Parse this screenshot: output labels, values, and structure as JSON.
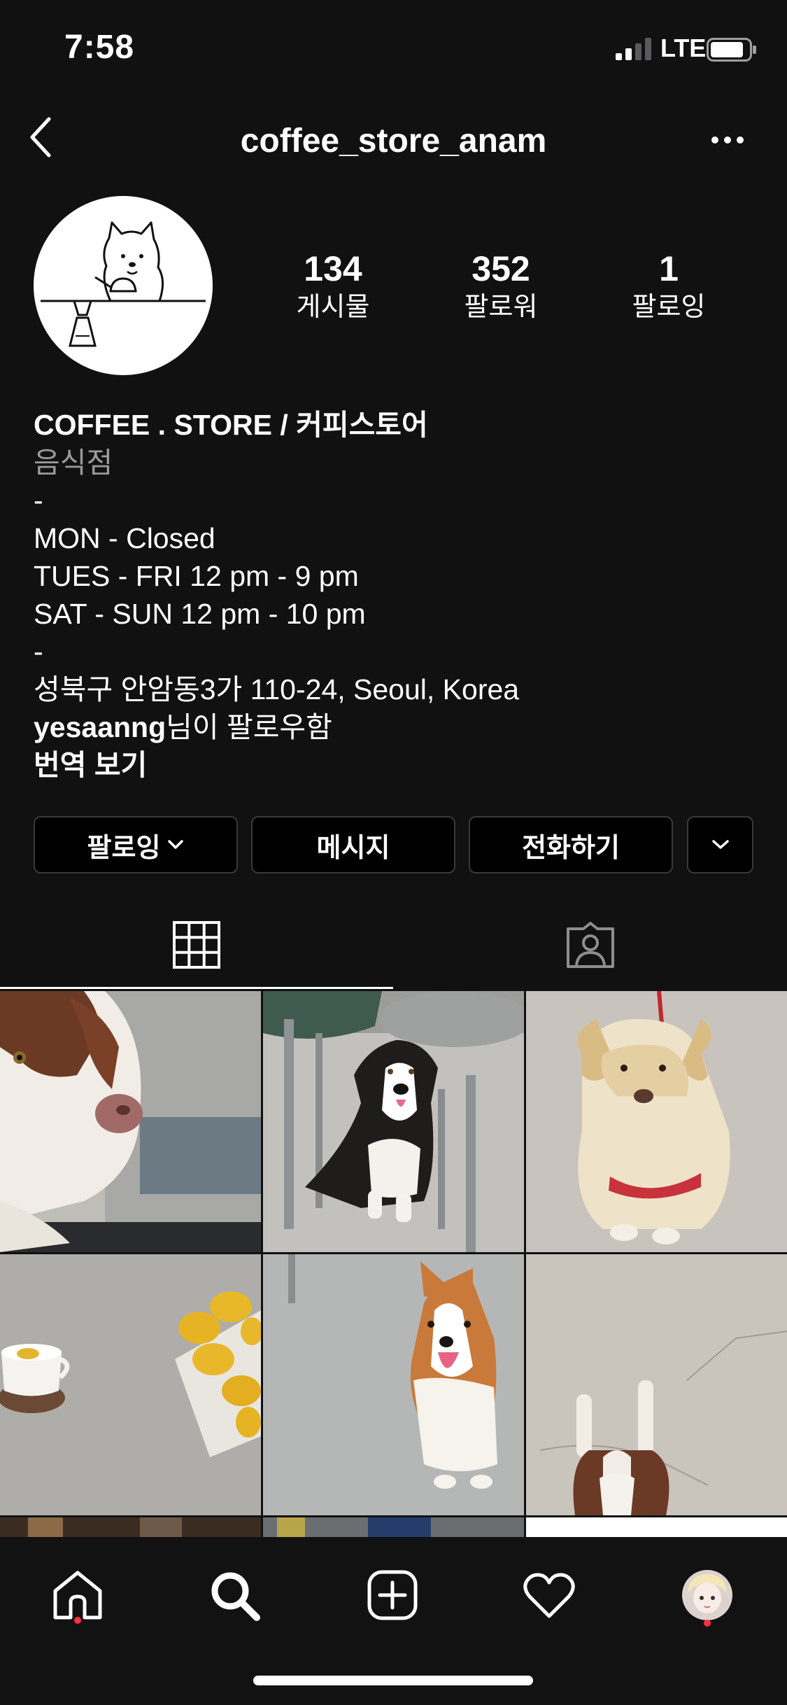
{
  "status_bar": {
    "time": "7:58",
    "network": "LTE"
  },
  "nav": {
    "username": "coffee_store_anam"
  },
  "profile": {
    "stats": [
      {
        "value": "134",
        "label": "게시물"
      },
      {
        "value": "352",
        "label": "팔로워"
      },
      {
        "value": "1",
        "label": "팔로잉"
      }
    ]
  },
  "bio": {
    "name": "COFFEE . STORE / 커피스토어",
    "category": "음식점",
    "lines": [
      "-",
      "MON - Closed",
      "TUES - FRI 12 pm - 9 pm",
      "SAT - SUN 12 pm - 10 pm",
      "-",
      "성북구 안암동3가 110-24, Seoul, Korea"
    ],
    "followed_by_user": "yesaanng",
    "followed_by_suffix": "님이 팔로우함",
    "translate": "번역 보기"
  },
  "actions": {
    "following": "팔로잉",
    "message": "메시지",
    "call": "전화하기"
  },
  "tabs": [
    {
      "name": "grid",
      "icon": "grid-icon",
      "active": true
    },
    {
      "name": "tagged",
      "icon": "tagged-person-icon",
      "active": false
    }
  ],
  "posts": [
    {
      "subject": "dog-closeup-brown-white"
    },
    {
      "subject": "dog-black-white-sitting-under-chairs"
    },
    {
      "subject": "dog-golden-red-harness"
    },
    {
      "subject": "coffee-cup-and-lemons"
    },
    {
      "subject": "corgi-smiling"
    },
    {
      "subject": "dog-lying-on-floor-top-view"
    }
  ],
  "bottom_nav": [
    {
      "name": "home",
      "icon": "home-icon",
      "notification_dot": true
    },
    {
      "name": "search",
      "icon": "search-icon",
      "notification_dot": false
    },
    {
      "name": "new-post",
      "icon": "plus-square-icon",
      "notification_dot": false
    },
    {
      "name": "activity",
      "icon": "heart-icon",
      "notification_dot": false
    },
    {
      "name": "profile",
      "icon": "profile-avatar-icon",
      "notification_dot": true
    }
  ],
  "colors": {
    "background": "#111112",
    "button_border": "#3a3a3c",
    "notification": "#ff3040",
    "secondary_text": "#9a9a9a"
  }
}
